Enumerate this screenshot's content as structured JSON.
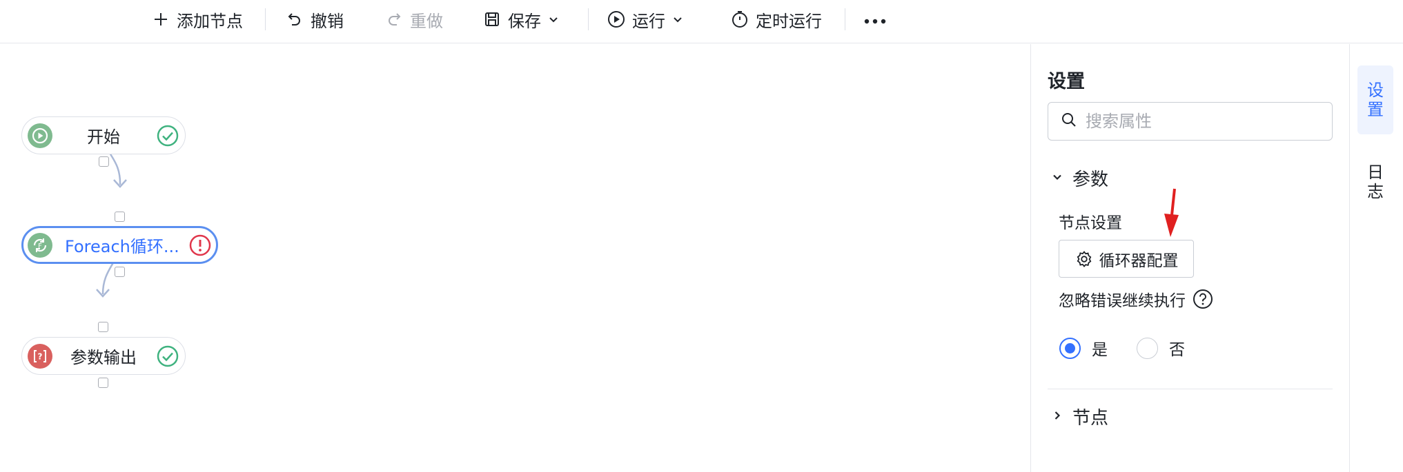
{
  "toolbar": {
    "add_node": "添加节点",
    "undo": "撤销",
    "redo": "重做",
    "save": "保存",
    "run": "运行",
    "scheduled_run": "定时运行"
  },
  "canvas": {
    "nodes": [
      {
        "label": "开始",
        "status": "success"
      },
      {
        "label": "Foreach循环...",
        "status": "error"
      },
      {
        "label": "参数输出",
        "status": "success"
      }
    ]
  },
  "settings": {
    "title": "设置",
    "search_placeholder": "搜索属性",
    "params_section": "参数",
    "node_settings_label": "节点设置",
    "loop_config_button": "循环器配置",
    "ignore_error_label": "忽略错误继续执行",
    "radio_yes": "是",
    "radio_no": "否",
    "selected_option": "是",
    "nodes_section": "节点"
  },
  "side_tabs": [
    {
      "label": "设置",
      "chars": [
        "设",
        "置"
      ],
      "active": true
    },
    {
      "label": "日志",
      "chars": [
        "日",
        "志"
      ],
      "active": false
    }
  ],
  "colors": {
    "accent": "#3370ff",
    "selected_border": "#5b8ff0",
    "success": "#3fb27f",
    "error": "#e0364b",
    "start_icon_bg": "#7fba8f",
    "output_icon_bg": "#d9605e",
    "arrow": "#e02020"
  }
}
